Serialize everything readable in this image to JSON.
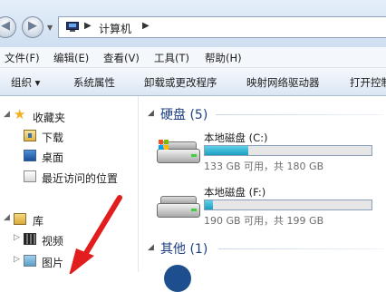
{
  "window": {
    "breadcrumb": "计算机"
  },
  "menubar": {
    "file": "文件(F)",
    "edit": "编辑(E)",
    "view": "查看(V)",
    "tools": "工具(T)",
    "help": "帮助(H)"
  },
  "toolbar": {
    "organize": "组织 ▾",
    "system_props": "系统属性",
    "uninstall": "卸载或更改程序",
    "map_drive": "映射网络驱动器",
    "open_control": "打开控制"
  },
  "navpane": {
    "favorites": "收藏夹",
    "downloads": "下载",
    "desktop": "桌面",
    "recent": "最近访问的位置",
    "libraries": "库",
    "videos": "视频",
    "pictures": "图片"
  },
  "content": {
    "hdd_group": "硬盘 (5)",
    "other_group": "其他 (1)",
    "drives": [
      {
        "name": "本地磁盘 (C:)",
        "size_text": "133 GB 可用，共 180 GB",
        "used_fraction": 0.26
      },
      {
        "name": "本地磁盘 (F:)",
        "size_text": "190 GB 可用，共 199 GB",
        "used_fraction": 0.05
      }
    ]
  },
  "colors": {
    "arrow": "#e21d1d",
    "bar_fill": "#26a8c9",
    "group_title": "#1e3f84"
  }
}
